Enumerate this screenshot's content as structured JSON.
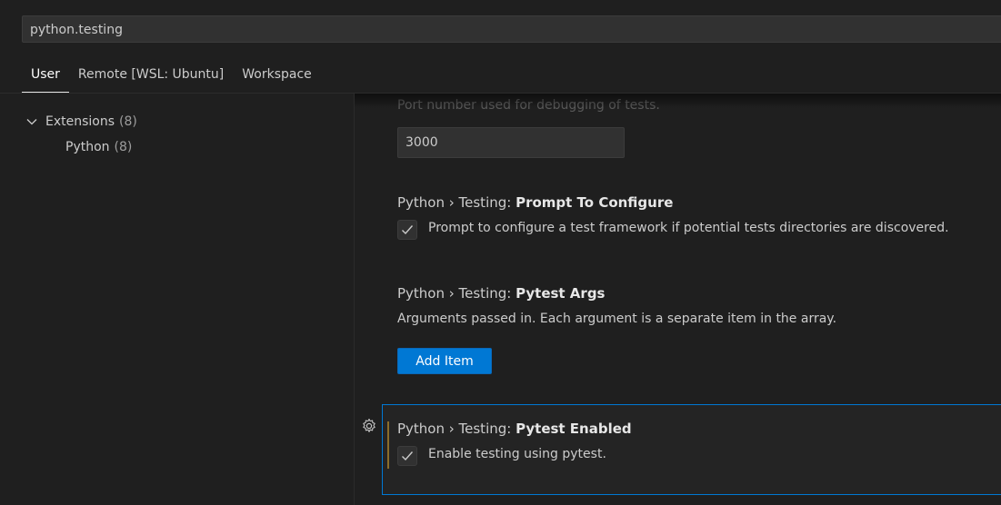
{
  "search": {
    "value": "python.testing"
  },
  "tabs": [
    {
      "label": "User",
      "active": true
    },
    {
      "label": "Remote [WSL: Ubuntu]",
      "active": false
    },
    {
      "label": "Workspace",
      "active": false
    }
  ],
  "toc": {
    "group": {
      "label": "Extensions",
      "count": "(8)"
    },
    "child": {
      "label": "Python",
      "count": "(8)"
    }
  },
  "settings": {
    "debug_port": {
      "description": "Port number used for debugging of tests.",
      "value": "3000"
    },
    "prompt_to_configure": {
      "category": "Python › Testing: ",
      "key": "Prompt To Configure",
      "checkbox_label": "Prompt to configure a test framework if potential tests directories are discovered.",
      "checked": true
    },
    "pytest_args": {
      "category": "Python › Testing: ",
      "key": "Pytest Args",
      "description": "Arguments passed in. Each argument is a separate item in the array.",
      "button_label": "Add Item"
    },
    "pytest_enabled": {
      "category": "Python › Testing: ",
      "key": "Pytest Enabled",
      "checkbox_label": "Enable testing using pytest.",
      "checked": true
    }
  },
  "icons": {
    "toc_expand": "chevron-down-icon",
    "checkbox": "check-icon",
    "row_settings": "gear-icon"
  },
  "colors": {
    "background": "#1f1f1f",
    "accent": "#0078d4",
    "modified_indicator": "#8a6d2b",
    "text": "#cccccc"
  }
}
